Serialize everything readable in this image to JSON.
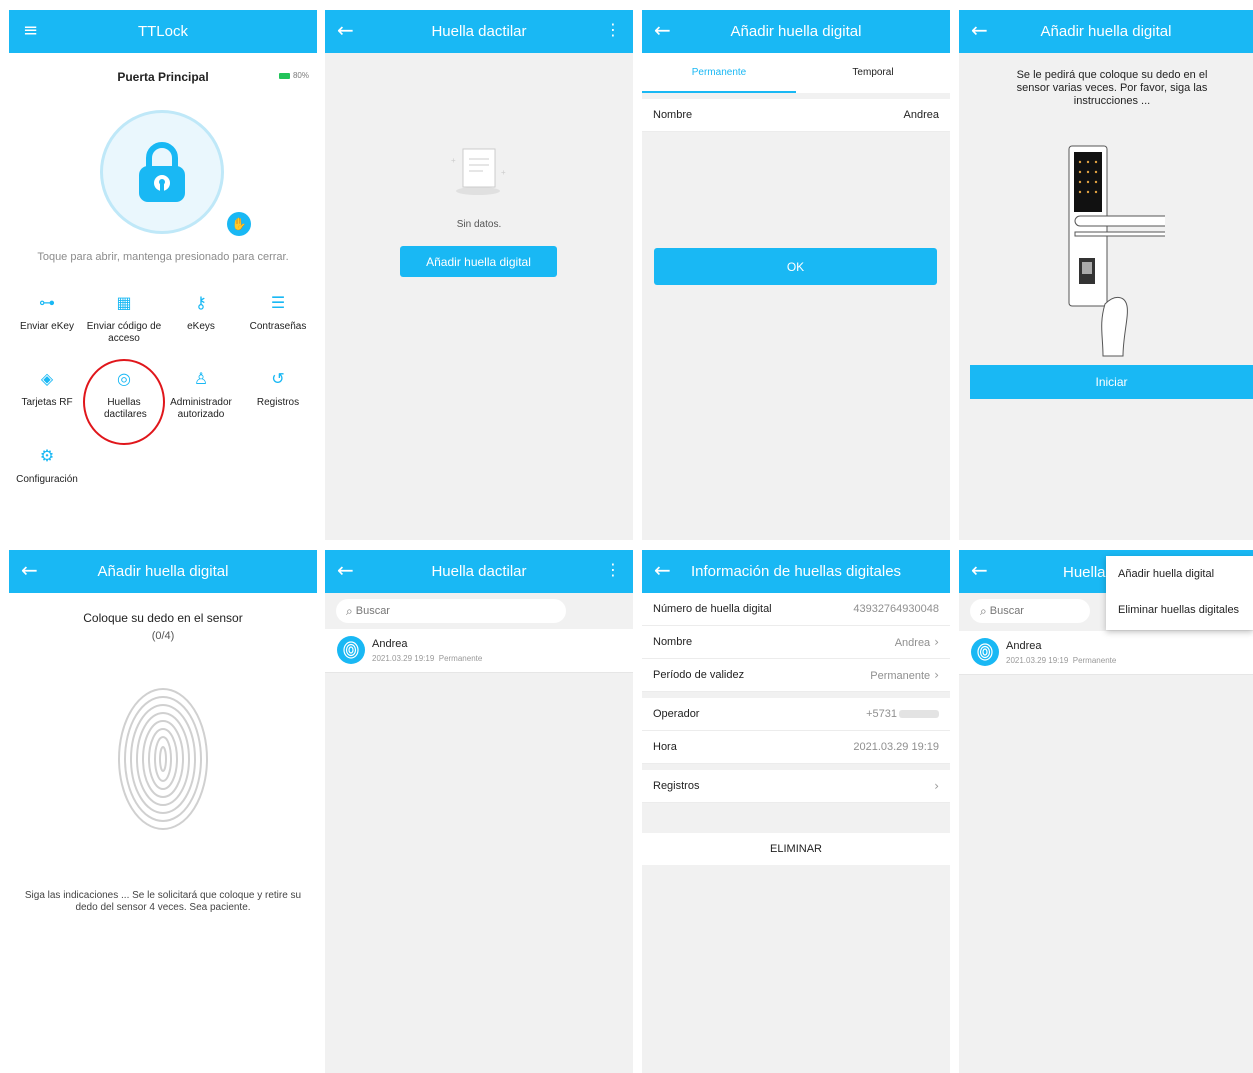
{
  "p1": {
    "title": "TTLock",
    "lock_name": "Puerta Principal",
    "battery": "80%",
    "hint": "Toque para abrir, mantenga presionado para cerrar.",
    "menu": [
      {
        "label": "Enviar eKey",
        "icon": "send-ekey-icon"
      },
      {
        "label": "Enviar código de acceso",
        "icon": "passcode-icon"
      },
      {
        "label": "eKeys",
        "icon": "ekeys-icon"
      },
      {
        "label": "Contraseñas",
        "icon": "passwords-icon"
      },
      {
        "label": "Tarjetas RF",
        "icon": "rf-card-icon"
      },
      {
        "label": "Huellas dactilares",
        "icon": "fingerprint-icon"
      },
      {
        "label": "Administrador autorizado",
        "icon": "admin-icon"
      },
      {
        "label": "Registros",
        "icon": "records-icon"
      },
      {
        "label": "Configuración",
        "icon": "settings-icon"
      }
    ],
    "highlight_color": "#e0161b"
  },
  "p2": {
    "title": "Huella dactilar",
    "empty": "Sin datos.",
    "add_button": "Añadir huella digital"
  },
  "p3": {
    "title": "Añadir huella digital",
    "tab_permanent": "Permanente",
    "tab_temporal": "Temporal",
    "name_label": "Nombre",
    "name_value": "Andrea",
    "ok": "OK"
  },
  "p4": {
    "title": "Añadir huella digital",
    "instructions": "Se le pedirá que coloque su dedo en el sensor varias veces. Por favor, siga las instrucciones ...",
    "start": "Iniciar"
  },
  "p5": {
    "title": "Añadir huella digital",
    "prompt": "Coloque su dedo en el sensor",
    "progress": "(0/4)",
    "footer": "Siga las indicaciones ... Se le solicitará que coloque y retire su dedo del sensor 4 veces. Sea paciente."
  },
  "p6": {
    "title": "Huella dactilar",
    "search_placeholder": "Buscar",
    "item_name": "Andrea",
    "item_date": "2021.03.29 19:19",
    "item_type": "Permanente"
  },
  "p7": {
    "title": "Información de huellas digitales",
    "number_label": "Número de huella digital",
    "number_value": "43932764930048",
    "name_label": "Nombre",
    "name_value": "Andrea",
    "validity_label": "Período de validez",
    "validity_value": "Permanente",
    "operator_label": "Operador",
    "operator_value": "+5731",
    "time_label": "Hora",
    "time_value": "2021.03.29 19:19",
    "records_label": "Registros",
    "delete": "ELIMINAR"
  },
  "p8": {
    "title": "Huella",
    "search_placeholder": "Buscar",
    "item_name": "Andrea",
    "item_date": "2021.03.29 19:19",
    "item_type": "Permanente",
    "menu_add": "Añadir huella digital",
    "menu_delete": "Eliminar huellas digitales"
  },
  "theme": {
    "accent": "#19b8f4"
  }
}
